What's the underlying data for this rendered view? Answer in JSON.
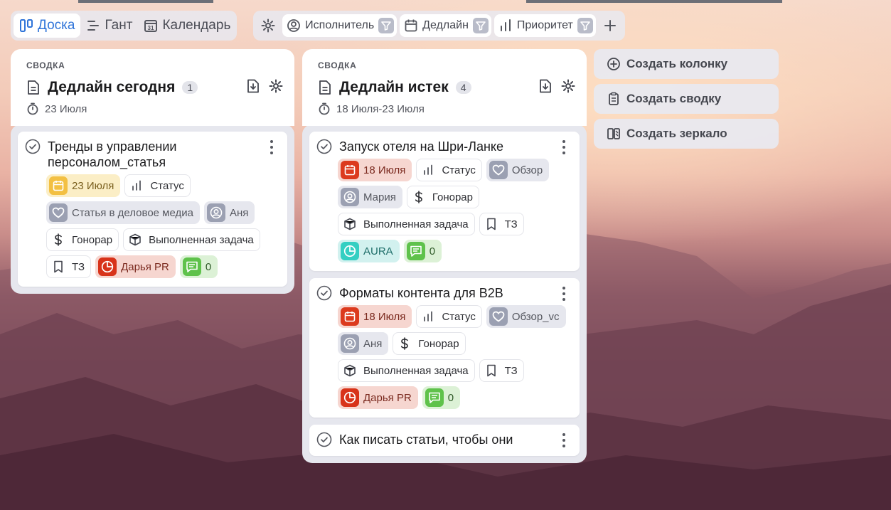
{
  "views": [
    {
      "label": "Доска",
      "active": true
    },
    {
      "label": "Гант",
      "active": false
    },
    {
      "label": "Календарь",
      "active": false
    }
  ],
  "filters": [
    {
      "label": "Исполнитель"
    },
    {
      "label": "Дедлайн"
    },
    {
      "label": "Приоритет"
    }
  ],
  "columns": [
    {
      "kind": "сводка",
      "title": "Дедлайн сегодня",
      "count": "1",
      "date": "23 Июля",
      "cards": [
        {
          "title": "Тренды в управлении персоналом_статья",
          "chips": [
            {
              "text": "23 Июля",
              "style": "date-today",
              "icon": "calendar-icon"
            },
            {
              "text": "Статус",
              "style": "plain",
              "icon": "bars-icon"
            },
            {
              "text": "Статья в деловое медиа",
              "style": "grey",
              "icon": "heart-icon"
            },
            {
              "text": "Аня",
              "style": "grey",
              "icon": "user-icon"
            },
            {
              "text": "Гонорар",
              "style": "plain",
              "icon": "dollar-icon"
            },
            {
              "text": "Выполненная задача",
              "style": "plain",
              "icon": "cube-icon"
            },
            {
              "text": "ТЗ",
              "style": "plain",
              "icon": "bookmark-icon"
            },
            {
              "text": "Дарья PR",
              "style": "red",
              "icon": "pie-icon"
            },
            {
              "text": "0",
              "style": "green",
              "icon": "comment-icon"
            }
          ]
        }
      ]
    },
    {
      "kind": "сводка",
      "title": "Дедлайн истек",
      "count": "4",
      "date": "18 Июля-23 Июля",
      "cards": [
        {
          "title": "Запуск отеля на Шри-Ланке",
          "chips": [
            {
              "text": "18 Июля",
              "style": "date-late",
              "icon": "calendar-icon"
            },
            {
              "text": "Статус",
              "style": "plain",
              "icon": "bars-icon"
            },
            {
              "text": "Обзор",
              "style": "grey",
              "icon": "heart-icon"
            },
            {
              "text": "Мария",
              "style": "grey",
              "icon": "user-icon"
            },
            {
              "text": "Гонорар",
              "style": "plain",
              "icon": "dollar-icon"
            },
            {
              "text": "Выполненная задача",
              "style": "plain",
              "icon": "cube-icon"
            },
            {
              "text": "ТЗ",
              "style": "plain",
              "icon": "bookmark-icon"
            },
            {
              "text": "AURA",
              "style": "teal",
              "icon": "pie-icon"
            },
            {
              "text": "0",
              "style": "green",
              "icon": "comment-icon"
            }
          ]
        },
        {
          "title": "Форматы контента для B2B",
          "chips": [
            {
              "text": "18 Июля",
              "style": "date-late",
              "icon": "calendar-icon"
            },
            {
              "text": "Статус",
              "style": "plain",
              "icon": "bars-icon"
            },
            {
              "text": "Обзор_vc",
              "style": "grey",
              "icon": "heart-icon"
            },
            {
              "text": "Аня",
              "style": "grey",
              "icon": "user-icon"
            },
            {
              "text": "Гонорар",
              "style": "plain",
              "icon": "dollar-icon"
            },
            {
              "text": "Выполненная задача",
              "style": "plain",
              "icon": "cube-icon"
            },
            {
              "text": "ТЗ",
              "style": "plain",
              "icon": "bookmark-icon"
            },
            {
              "text": "Дарья PR",
              "style": "red",
              "icon": "pie-icon"
            },
            {
              "text": "0",
              "style": "green",
              "icon": "comment-icon"
            }
          ]
        },
        {
          "title": "Как писать статьи, чтобы они",
          "chips": []
        }
      ]
    }
  ],
  "side_actions": [
    {
      "label": "Создать колонку",
      "icon": "plus-circle-icon"
    },
    {
      "label": "Создать сводку",
      "icon": "clipboard-icon"
    },
    {
      "label": "Создать зеркало",
      "icon": "mirror-icon"
    }
  ],
  "colors": {
    "accent": "#2f74d9",
    "late": "#dc3a1e",
    "today": "#f3c043"
  }
}
